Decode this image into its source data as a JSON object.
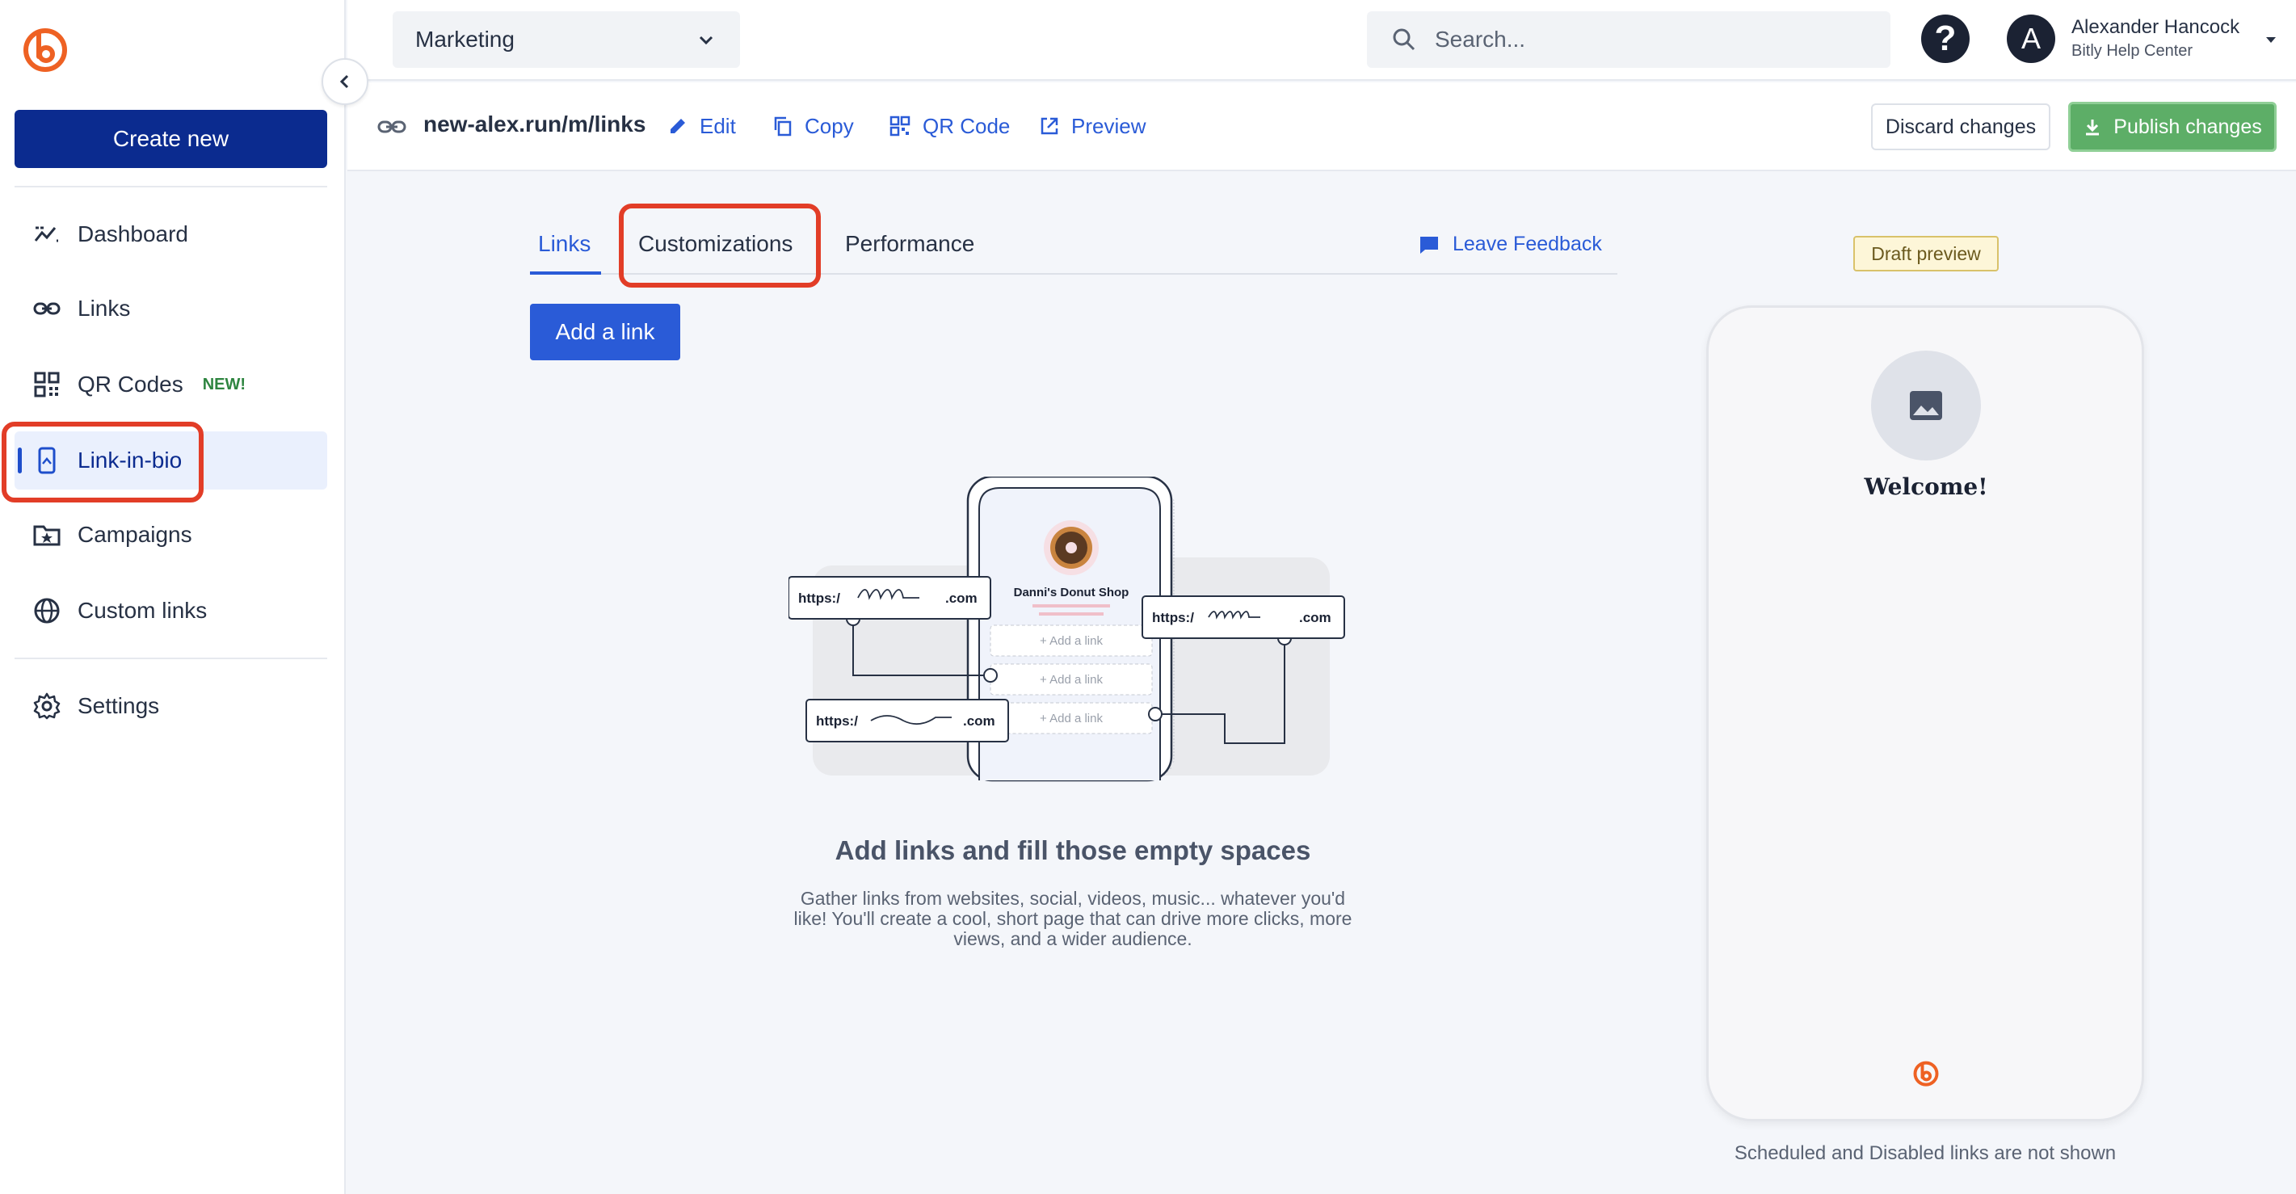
{
  "app": {
    "brand_color": "#ee6123",
    "accent": "#2a5bd7",
    "publish_color": "#5dae67"
  },
  "sidebar": {
    "create_label": "Create new",
    "items": [
      {
        "label": "Dashboard",
        "icon": "trend-icon"
      },
      {
        "label": "Links",
        "icon": "link-icon"
      },
      {
        "label": "QR Codes",
        "icon": "qr-icon",
        "badge": "NEW!"
      },
      {
        "label": "Link-in-bio",
        "icon": "phone-icon",
        "active": true
      },
      {
        "label": "Campaigns",
        "icon": "folder-star-icon"
      },
      {
        "label": "Custom links",
        "icon": "globe-icon"
      },
      {
        "label": "Settings",
        "icon": "gear-icon"
      }
    ]
  },
  "header": {
    "org_select": "Marketing",
    "search_placeholder": "Search...",
    "help_glyph": "?",
    "avatar_initial": "A",
    "user_name": "Alexander Hancock",
    "user_sub": "Bitly Help Center"
  },
  "subbar": {
    "url": "new-alex.run/m/links",
    "edit": "Edit",
    "copy": "Copy",
    "qr": "QR Code",
    "preview": "Preview",
    "discard": "Discard changes",
    "publish": "Publish changes"
  },
  "main": {
    "tabs": [
      "Links",
      "Customizations",
      "Performance"
    ],
    "feedback": "Leave Feedback",
    "add_link": "Add a link",
    "illustration": {
      "shop_name": "Danni's Donut Shop",
      "url_prefix": "https:/",
      "url_suffix": ".com",
      "add_link_slot": "+ Add a link"
    },
    "empty_title": "Add links and fill those empty spaces",
    "empty_desc": "Gather links from websites, social, videos, music... whatever you'd like! You'll create a cool, short page that can drive more clicks, more views, and a wider audience."
  },
  "preview": {
    "draft_badge": "Draft preview",
    "welcome": "Welcome!",
    "note": "Scheduled and Disabled links are not shown"
  }
}
